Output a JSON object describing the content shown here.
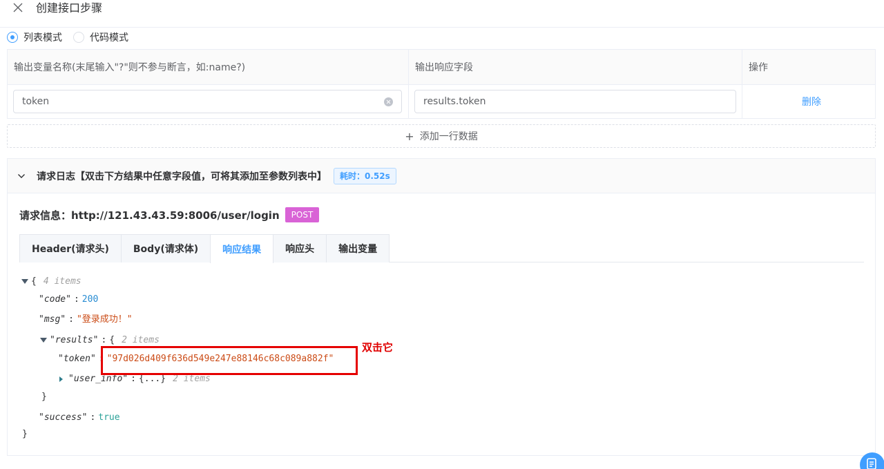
{
  "header": {
    "title": "创建接口步骤"
  },
  "mode": {
    "list_label": "列表模式",
    "code_label": "代码模式",
    "selected": "列表模式"
  },
  "table": {
    "headers": [
      "输出变量名称(末尾输入\"?\"则不参与断言，如:name?)",
      "输出响应字段",
      "操作"
    ],
    "rows": [
      {
        "var_name": "token",
        "field": "results.token",
        "action": "删除"
      }
    ]
  },
  "add_row_label": "添加一行数据",
  "log": {
    "title": "请求日志【双击下方结果中任意字段值，可将其添加至参数列表中】",
    "time_label": "耗时：",
    "time_value": "0.52s",
    "request_info": "请求信息：http://121.43.43.59:8006/user/login",
    "method": "POST",
    "tabs": [
      "Header(请求头)",
      "Body(请求体)",
      "响应结果",
      "响应头",
      "输出变量"
    ],
    "active_tab": "响应结果"
  },
  "json_view": {
    "root_meta": "4 items",
    "code_key": "\"code\"",
    "code_value": "200",
    "msg_key": "\"msg\"",
    "msg_value": "\"登录成功！\"",
    "results_key": "\"results\"",
    "results_meta": "2 items",
    "token_key": "\"token\"",
    "token_value": "\"97d026d409f636d549e247e88146c68c089a882f\"",
    "user_info_key": "\"user_info\"",
    "user_info_value": "{...}",
    "user_info_meta": "2 items",
    "success_key": "\"success\"",
    "success_value": "true"
  },
  "annotation": "双击它",
  "colors": {
    "accent": "#409eff",
    "method_tag": "#d963d6",
    "highlight_box": "#e50000"
  }
}
